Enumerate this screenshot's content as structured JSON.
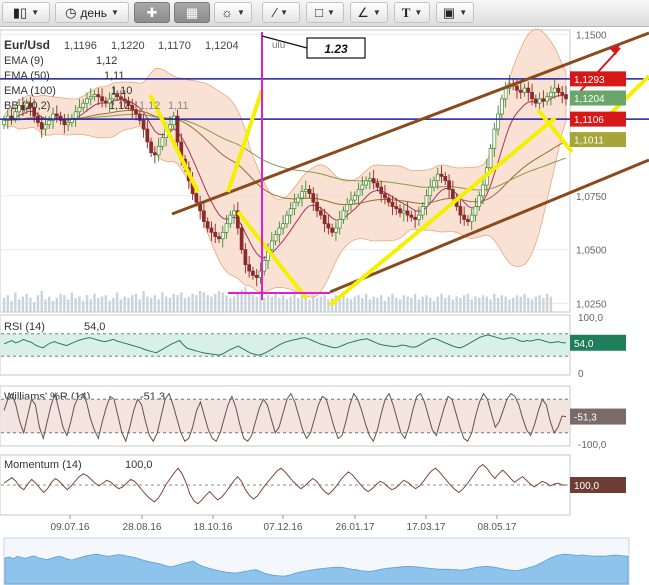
{
  "toolbar": {
    "candles_icon": "candles-icon",
    "period_label": "день",
    "crosshair_icon": "crosshair-icon",
    "indicators_icon": "indicators-icon",
    "weather_icon": "events-icon",
    "line_tool_icon": "line-tool-icon",
    "shape_tool_icon": "rectangle-tool-icon",
    "fib_tool_icon": "fibonacci-tool-icon",
    "text_tool_label": "T",
    "image_tool_icon": "image-icon"
  },
  "colors": {
    "blue_line": "#1e1ea8",
    "brown_channel": "#8b4a1c",
    "yellow_drawing": "#f4f000",
    "magenta_drawing": "#e020d0",
    "candle_up": "#3a8a2a",
    "candle_down": "#8a2a2a",
    "band_fill": "#f7d8c4",
    "rsi_fill": "#d8f0e8",
    "rsi_line": "#2a7a5a",
    "williams_fill": "#f3e4e0",
    "williams_line": "#6a5050",
    "momentum_line": "#7a4a3a",
    "tag_red": "#d81818",
    "tag_green": "#6aa56a",
    "tag_olive": "#a5a53a",
    "navigator": "#8ec3ec"
  },
  "chart_data": [
    {
      "type": "candlestick",
      "symbol": "Eur/Usd",
      "ohlc_header": [
        "1,1196",
        "1,1220",
        "1,1170",
        "1,1204"
      ],
      "legend": [
        {
          "name": "EMA (9)",
          "value": "1,12"
        },
        {
          "name": "EMA (50)",
          "value": "1,11"
        },
        {
          "name": "EMA (100)",
          "value": "1,10"
        },
        {
          "name": "BB (20,2)",
          "value": "1,12",
          "extra": [
            "1,12",
            "1,11"
          ]
        }
      ],
      "annotation_box": "1.23",
      "annotation_cut": "ulu",
      "y_ticks": [
        {
          "label": "1,1500",
          "v": 1.15
        },
        {
          "label": "1,0750",
          "v": 1.075
        },
        {
          "label": "1,0500",
          "v": 1.05
        },
        {
          "label": "1,0250",
          "v": 1.025
        }
      ],
      "ylim": [
        1.021,
        1.152
      ],
      "price_tags": [
        {
          "label": "1,1293",
          "v": 1.1293,
          "color": "#d81818"
        },
        {
          "label": "1,1204",
          "v": 1.1204,
          "color": "#6aa56a"
        },
        {
          "label": "1,1106",
          "v": 1.1106,
          "color": "#d81818"
        },
        {
          "label": "1,1011",
          "v": 1.1011,
          "color": "#a5a53a"
        }
      ],
      "horizontal_lines": [
        1.1293,
        1.1106
      ],
      "x_dates": [
        "09.07.16",
        "28.08.16",
        "18.10.16",
        "07.12.16",
        "26.01.17",
        "17.03.17",
        "08.05.17"
      ],
      "close": [
        1.11,
        1.112,
        1.111,
        1.114,
        1.117,
        1.115,
        1.118,
        1.116,
        1.112,
        1.109,
        1.106,
        1.108,
        1.11,
        1.113,
        1.112,
        1.11,
        1.108,
        1.109,
        1.111,
        1.114,
        1.116,
        1.118,
        1.12,
        1.121,
        1.122,
        1.121,
        1.119,
        1.118,
        1.12,
        1.122,
        1.121,
        1.12,
        1.119,
        1.117,
        1.115,
        1.113,
        1.11,
        1.106,
        1.1,
        1.095,
        1.094,
        1.098,
        1.102,
        1.106,
        1.108,
        1.112,
        1.1,
        1.092,
        1.088,
        1.082,
        1.076,
        1.072,
        1.068,
        1.063,
        1.06,
        1.058,
        1.056,
        1.055,
        1.058,
        1.062,
        1.066,
        1.068,
        1.06,
        1.05,
        1.043,
        1.04,
        1.038,
        1.037,
        1.04,
        1.045,
        1.05,
        1.054,
        1.057,
        1.06,
        1.062,
        1.066,
        1.069,
        1.072,
        1.074,
        1.077,
        1.078,
        1.076,
        1.072,
        1.068,
        1.066,
        1.062,
        1.06,
        1.058,
        1.06,
        1.064,
        1.068,
        1.071,
        1.073,
        1.075,
        1.078,
        1.08,
        1.082,
        1.083,
        1.081,
        1.079,
        1.076,
        1.074,
        1.072,
        1.07,
        1.069,
        1.067,
        1.068,
        1.066,
        1.065,
        1.064,
        1.066,
        1.07,
        1.075,
        1.079,
        1.082,
        1.085,
        1.084,
        1.082,
        1.078,
        1.074,
        1.07,
        1.066,
        1.064,
        1.063,
        1.066,
        1.07,
        1.075,
        1.08,
        1.088,
        1.097,
        1.106,
        1.113,
        1.12,
        1.125,
        1.127,
        1.126,
        1.124,
        1.123,
        1.125,
        1.123,
        1.12,
        1.118,
        1.12,
        1.119,
        1.121,
        1.123,
        1.125,
        1.123,
        1.122,
        1.12
      ],
      "volume": [
        10,
        12,
        8,
        14,
        9,
        11,
        13,
        10,
        7,
        12,
        15,
        9,
        11,
        8,
        10,
        13,
        12,
        9,
        14,
        10,
        11,
        8,
        12,
        9,
        13,
        10,
        11,
        12,
        8,
        10,
        14,
        9,
        11,
        10,
        12,
        13,
        9,
        15,
        11,
        10,
        12,
        9,
        14,
        11,
        10,
        13,
        12,
        14,
        10,
        11,
        13,
        12,
        15,
        14,
        12,
        11,
        13,
        15,
        14,
        12,
        10,
        11,
        13,
        16,
        18,
        14,
        12,
        11,
        13,
        10,
        12,
        11,
        14,
        10,
        12,
        9,
        11,
        13,
        10,
        12,
        11,
        9,
        13,
        10,
        11,
        12,
        9,
        10,
        12,
        11,
        13,
        10,
        9,
        11,
        12,
        10,
        13,
        9,
        11,
        10,
        12,
        8,
        11,
        13,
        10,
        9,
        12,
        11,
        10,
        13,
        9,
        11,
        12,
        10,
        8,
        11,
        13,
        10,
        12,
        9,
        11,
        10,
        12,
        13,
        9,
        11,
        10,
        12,
        11,
        9,
        13,
        10,
        12,
        11,
        9,
        10,
        12,
        11,
        13,
        10,
        9,
        11,
        12,
        10,
        13,
        11
      ]
    },
    {
      "type": "line",
      "name": "RSI (14)",
      "value": "54,0",
      "y_ticks": [
        {
          "label": "100,0",
          "v": 100
        },
        {
          "label": "0",
          "v": 0
        }
      ],
      "ylim": [
        0,
        100
      ],
      "levels": [
        70,
        30
      ],
      "values": [
        52,
        55,
        58,
        54,
        56,
        60,
        57,
        55,
        50,
        47,
        45,
        50,
        54,
        56,
        53,
        51,
        49,
        52,
        55,
        58,
        60,
        62,
        63,
        61,
        59,
        57,
        56,
        58,
        60,
        57,
        55,
        53,
        51,
        49,
        47,
        45,
        42,
        40,
        38,
        36,
        40,
        44,
        48,
        52,
        55,
        58,
        50,
        44,
        42,
        40,
        38,
        36,
        35,
        34,
        33,
        32,
        34,
        38,
        42,
        45,
        48,
        44,
        40,
        36,
        34,
        32,
        33,
        36,
        40,
        44,
        48,
        52,
        55,
        57,
        59,
        60,
        62,
        63,
        61,
        58,
        55,
        52,
        50,
        48,
        46,
        45,
        47,
        50,
        53,
        55,
        57,
        59,
        60,
        61,
        58,
        55,
        52,
        50,
        49,
        48,
        47,
        48,
        50,
        49,
        47,
        46,
        48,
        52,
        56,
        60,
        62,
        60,
        57,
        54,
        51,
        48,
        46,
        45,
        48,
        52,
        56,
        60,
        64,
        66,
        68,
        66,
        64,
        62,
        60,
        62,
        63,
        61,
        58,
        56,
        58,
        57,
        59,
        60,
        58,
        56,
        54,
        55,
        56,
        54,
        54
      ],
      "value_tag_color": "#1f7f5a"
    },
    {
      "type": "line",
      "name": "Williams' %R (14)",
      "value": "-51,3",
      "y_ticks": [
        {
          "label": "-100,0",
          "v": -100
        }
      ],
      "ylim": [
        -100,
        0
      ],
      "levels": [
        -20,
        -80
      ],
      "values": [
        -40,
        -20,
        -10,
        -30,
        -60,
        -80,
        -50,
        -20,
        -30,
        -70,
        -90,
        -60,
        -30,
        -10,
        -40,
        -70,
        -85,
        -60,
        -30,
        -15,
        -10,
        -25,
        -55,
        -75,
        -90,
        -60,
        -35,
        -15,
        -20,
        -50,
        -80,
        -95,
        -70,
        -40,
        -20,
        -30,
        -60,
        -85,
        -95,
        -80,
        -50,
        -20,
        -10,
        -30,
        -55,
        -80,
        -95,
        -90,
        -70,
        -40,
        -25,
        -50,
        -75,
        -90,
        -95,
        -80,
        -55,
        -30,
        -15,
        -35,
        -65,
        -90,
        -95,
        -85,
        -60,
        -35,
        -20,
        -30,
        -55,
        -80,
        -70,
        -45,
        -20,
        -10,
        -25,
        -50,
        -75,
        -90,
        -80,
        -55,
        -30,
        -15,
        -20,
        -45,
        -70,
        -90,
        -85,
        -60,
        -30,
        -10,
        -20,
        -40,
        -65,
        -85,
        -95,
        -75,
        -45,
        -20,
        -10,
        -30,
        -55,
        -80,
        -90,
        -70,
        -40,
        -15,
        -10,
        -25,
        -50,
        -75,
        -85,
        -60,
        -35,
        -15,
        -20,
        -45,
        -70,
        -90,
        -95,
        -80,
        -50,
        -25,
        -10,
        -20,
        -45,
        -70,
        -60,
        -40,
        -20,
        -10,
        -15,
        -30,
        -55,
        -75,
        -85,
        -65,
        -40,
        -20,
        -30,
        -60,
        -80,
        -70,
        -50,
        -51
      ],
      "value_tag_color": "#7a6a6a"
    },
    {
      "type": "line",
      "name": "Momentum (14)",
      "value": "100,0",
      "levels": [
        100
      ],
      "ylim": [
        97,
        103
      ],
      "values": [
        100.2,
        100.5,
        100.8,
        100.4,
        99.8,
        99.5,
        100.1,
        100.6,
        100.2,
        99.7,
        99.2,
        99.6,
        100.3,
        100.7,
        100.4,
        99.9,
        99.5,
        99.9,
        100.4,
        100.9,
        101.2,
        101.0,
        100.6,
        100.2,
        99.9,
        100.2,
        100.5,
        100.3,
        99.9,
        99.6,
        99.8,
        100.2,
        100.6,
        100.4,
        99.9,
        99.4,
        98.9,
        98.5,
        98.2,
        98.6,
        99.3,
        100.1,
        100.7,
        101.3,
        101.8,
        101.2,
        100.2,
        99.0,
        98.3,
        98.0,
        98.4,
        98.9,
        99.3,
        98.8,
        98.4,
        98.7,
        99.2,
        99.8,
        100.4,
        100.9,
        100.4,
        99.5,
        98.9,
        98.5,
        98.8,
        99.4,
        100.0,
        100.5,
        101.0,
        101.5,
        101.8,
        101.4,
        100.9,
        100.4,
        100.0,
        99.6,
        99.9,
        100.3,
        100.7,
        100.4,
        99.8,
        99.3,
        99.0,
        99.4,
        99.9,
        100.5,
        101.0,
        101.4,
        101.1,
        100.6,
        100.1,
        99.6,
        99.3,
        99.6,
        100.0,
        100.4,
        100.2,
        99.8,
        99.5,
        99.7,
        100.1,
        100.5,
        100.3,
        99.9,
        99.6,
        99.9,
        100.4,
        101.0,
        101.5,
        101.8,
        101.4,
        100.9,
        100.4,
        99.9,
        99.5,
        99.2,
        99.6,
        100.1,
        100.7,
        101.3,
        101.9,
        102.2,
        101.8,
        101.2,
        100.7,
        101.2,
        101.6,
        101.2,
        100.7,
        100.3,
        100.6,
        100.9,
        100.5,
        100.1,
        99.8,
        100.1,
        100.4,
        100.2,
        99.9,
        100.1,
        100.2,
        100.0,
        100.0
      ],
      "value_tag_color": "#6e3e34"
    },
    {
      "type": "area",
      "name": "navigator",
      "values": [
        62,
        64,
        60,
        66,
        63,
        61,
        65,
        67,
        62,
        60,
        58,
        61,
        64,
        66,
        63,
        59,
        57,
        60,
        63,
        66,
        68,
        70,
        71,
        69,
        67,
        66,
        68,
        70,
        69,
        67,
        65,
        63,
        60,
        57,
        54,
        52,
        50,
        48,
        45,
        42,
        41,
        44,
        47,
        50,
        52,
        55,
        48,
        43,
        40,
        37,
        34,
        32,
        30,
        28,
        27,
        26,
        27,
        29,
        31,
        33,
        34,
        30,
        26,
        23,
        21,
        20,
        19,
        19,
        21,
        24,
        27,
        29,
        31,
        33,
        34,
        36,
        37,
        38,
        39,
        40,
        40,
        39,
        37,
        35,
        34,
        32,
        31,
        30,
        31,
        33,
        35,
        37,
        38,
        39,
        40,
        41,
        42,
        42,
        41,
        40,
        39,
        38,
        37,
        36,
        35,
        35,
        35,
        34,
        34,
        33,
        34,
        36,
        38,
        40,
        41,
        42,
        41,
        40,
        38,
        36,
        34,
        33,
        32,
        33,
        35,
        38,
        41,
        44,
        49,
        54,
        60,
        64,
        68,
        70,
        71,
        70,
        69,
        68,
        69,
        68,
        67,
        66,
        67,
        66,
        67,
        68,
        69,
        68,
        67,
        66
      ]
    }
  ]
}
